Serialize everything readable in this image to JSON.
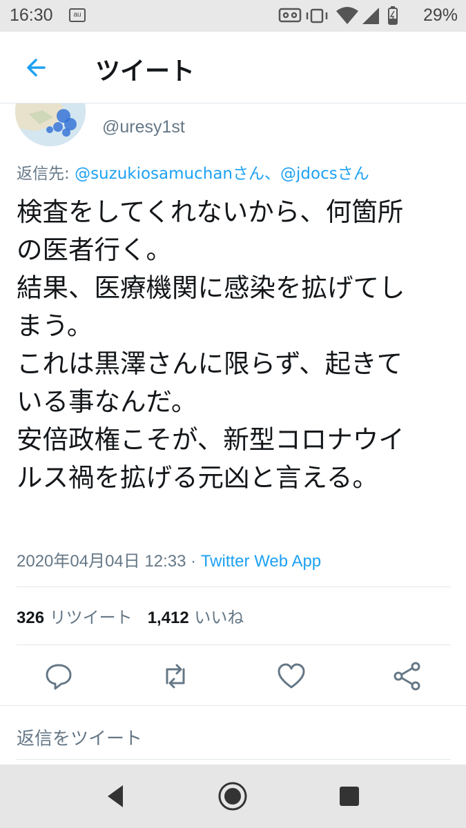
{
  "status_bar": {
    "time": "16:30",
    "carrier_icon": "au",
    "battery_percent": "29%",
    "icons": [
      "vr-icon",
      "vibrate-icon",
      "wifi-icon",
      "signal-icon",
      "battery-icon"
    ]
  },
  "header": {
    "title": "ツイート"
  },
  "author": {
    "handle": "@uresy1st"
  },
  "reply_to": {
    "prefix": "返信先: ",
    "user1": "@suzukiosamuchanさん",
    "separator": "、",
    "user2": "@jdocsさん"
  },
  "tweet": {
    "lines": [
      "検査をしてくれないから、何箇所",
      "の医者行く。",
      "結果、医療機関に感染を拡げてし",
      "まう。",
      "これは黒澤さんに限らず、起きて",
      "いる事なんだ。",
      "安倍政権こそが、新型コロナウイ",
      "ルス禍を拡げる元凶と言える。"
    ],
    "timestamp": "2020年04月04日 12:33",
    "dot": " · ",
    "source": "Twitter Web App"
  },
  "stats": {
    "retweet_count": "326",
    "retweet_label": "リツイート",
    "like_count": "1,412",
    "like_label": "いいね"
  },
  "reply_box": {
    "placeholder": "返信をツイート"
  },
  "colors": {
    "accent": "#1da1f2",
    "secondary_text": "#657786",
    "primary_text": "#14171a",
    "divider": "#e1e8ed"
  }
}
